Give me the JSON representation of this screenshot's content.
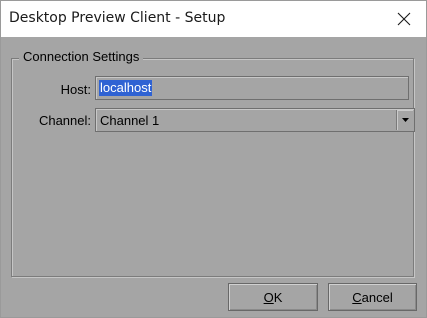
{
  "window": {
    "title": "Desktop Preview Client - Setup"
  },
  "icons": {
    "close": "close-icon",
    "dropdown": "chevron-down-icon"
  },
  "group": {
    "legend": "Connection Settings"
  },
  "host": {
    "label": "Host:",
    "value": "localhost"
  },
  "channel": {
    "label": "Channel:",
    "selected": "Channel 1"
  },
  "buttons": {
    "ok": {
      "mnemonic": "O",
      "rest": "K"
    },
    "cancel": {
      "mnemonic": "C",
      "rest": "ancel"
    }
  },
  "colors": {
    "dialog_background": "#a5a5a5",
    "selection_highlight": "#2f62d3",
    "titlebar_background": "#ffffff"
  }
}
